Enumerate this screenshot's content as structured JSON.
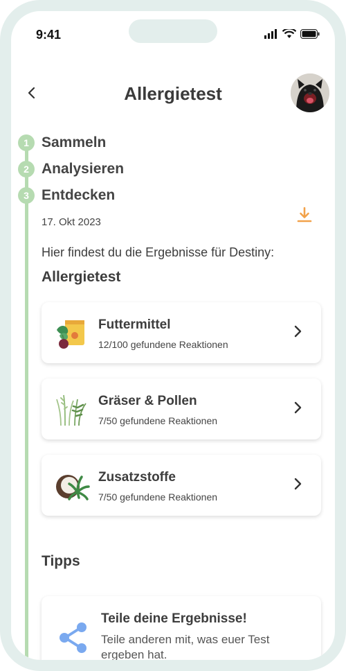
{
  "status_bar": {
    "time": "9:41"
  },
  "header": {
    "title": "Allergietest",
    "back_icon": "chevron-left-icon"
  },
  "steps": [
    {
      "number": "1",
      "label": "Sammeln"
    },
    {
      "number": "2",
      "label": "Analysieren"
    },
    {
      "number": "3",
      "label": "Entdecken",
      "date": "17. Okt 2023"
    }
  ],
  "intro": "Hier findest du die Ergebnisse für Destiny:",
  "allergy_section": {
    "title": "Allergietest",
    "cards": [
      {
        "title": "Futtermittel",
        "subtitle": "12/100 gefundene Reaktionen",
        "icon": "food-bag-icon"
      },
      {
        "title": "Gräser & Pollen",
        "subtitle": "7/50 gefundene Reaktionen",
        "icon": "grass-icon"
      },
      {
        "title": "Zusatzstoffe",
        "subtitle": "7/50 gefundene Reaktionen",
        "icon": "coconut-leaf-icon"
      }
    ]
  },
  "tips_section": {
    "title": "Tipps",
    "card": {
      "title": "Teile deine Ergebnisse!",
      "text": "Teile anderen mit, was euer Test ergeben hat.",
      "icon": "share-icon"
    }
  },
  "colors": {
    "timeline": "#b6dbb1",
    "accent_orange": "#f2a24a",
    "share_blue": "#7aa9ef",
    "frame": "#e3eeec"
  }
}
